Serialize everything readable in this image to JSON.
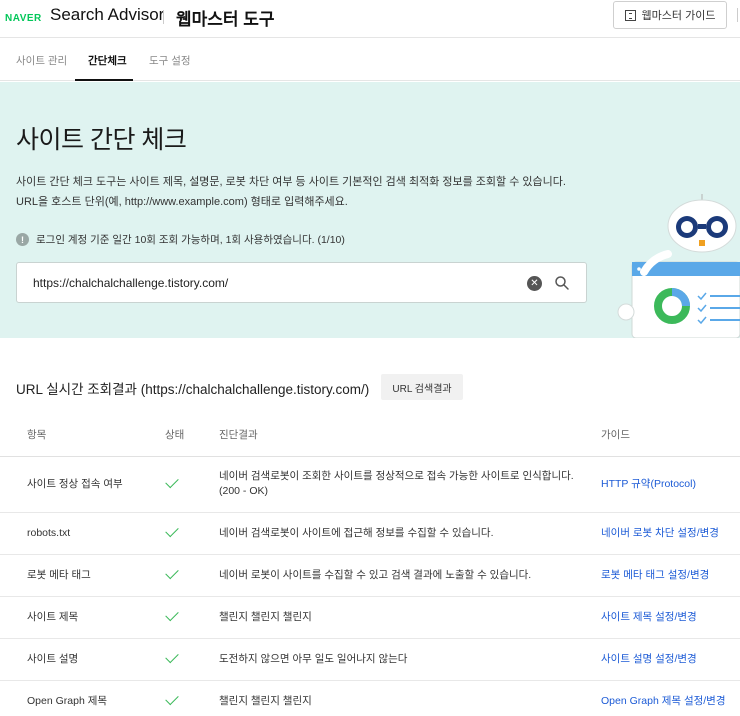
{
  "header": {
    "naver_logo": "NAVER",
    "app_name": "Search Advisor",
    "tool_name": "웹마스터 도구",
    "guide_button": "웹마스터 가이드"
  },
  "tabs": [
    {
      "label": "사이트 관리",
      "active": false
    },
    {
      "label": "간단체크",
      "active": true
    },
    {
      "label": "도구 설정",
      "active": false
    }
  ],
  "hero": {
    "title": "사이트 간단 체크",
    "desc_line1": "사이트 간단 체크 도구는 사이트 제목, 설명문, 로봇 차단 여부 등 사이트 기본적인 검색 최적화 정보를 조회할 수 있습니다.",
    "desc_line2": "URL을 호스트 단위(예, http://www.example.com) 형태로 입력해주세요.",
    "notice": "로그인 계정 기준 일간 10회 조회 가능하며, 1회 사용하였습니다. (1/10)",
    "background_color": "#dff3f0"
  },
  "search": {
    "value": "https://chalchalchallenge.tistory.com/"
  },
  "results": {
    "title": "URL 실시간 조회결과 (https://chalchalchallenge.tistory.com/)",
    "button": "URL 검색결과",
    "headers": [
      "항목",
      "상태",
      "진단결과",
      "가이드"
    ],
    "rows": [
      {
        "item": "사이트 정상 접속 여부",
        "status": "ok",
        "result": "네이버 검색로봇이 조회한 사이트를 정상적으로 접속 가능한 사이트로 인식합니다.",
        "result2": "(200 - OK)",
        "guide": "HTTP 규약(Protocol)"
      },
      {
        "item": "robots.txt",
        "status": "ok",
        "result": "네이버 검색로봇이 사이트에 접근해 정보를 수집할 수 있습니다.",
        "result2": "",
        "guide": "네이버 로봇 차단 설정/변경"
      },
      {
        "item": "로봇 메타 태그",
        "status": "ok",
        "result": "네이버 로봇이 사이트를 수집할 수 있고 검색 결과에 노출할 수 있습니다.",
        "result2": "",
        "guide": "로봇 메타 태그 설정/변경"
      },
      {
        "item": "사이트 제목",
        "status": "ok",
        "result": "챌린지 챌린지 챌린지",
        "result2": "",
        "guide": "사이트 제목 설정/변경"
      },
      {
        "item": "사이트 설명",
        "status": "ok",
        "result": "도전하지 않으면 아무 일도 일어나지 않는다",
        "result2": "",
        "guide": "사이트 설명 설정/변경"
      },
      {
        "item": "Open Graph 제목",
        "status": "ok",
        "result": "챌린지 챌린지 챌린지",
        "result2": "",
        "guide": "Open Graph 제목 설정/변경"
      }
    ],
    "link_color": "#1c5bd6",
    "check_color": "#3cb95a"
  }
}
